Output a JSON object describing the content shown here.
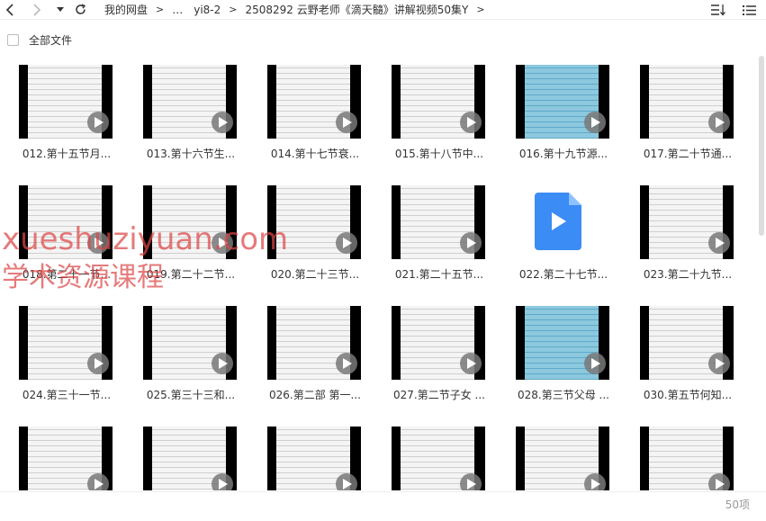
{
  "toolbar": {
    "breadcrumb": [
      "我的网盘",
      "…",
      "yi8-2",
      "2508292 云野老师《滴天髓》讲解视频50集Y"
    ],
    "separator": ">",
    "back_icon": "chevron-left-icon",
    "forward_icon": "chevron-right-icon",
    "history_icon": "caret-down-icon",
    "refresh_icon": "refresh-icon",
    "sort_icon": "sort-icon",
    "view_icon": "list-view-icon"
  },
  "select_all": {
    "label": "全部文件"
  },
  "files": [
    {
      "name": "012.第十五节月...",
      "thumb": "doc"
    },
    {
      "name": "013.第十六节生...",
      "thumb": "doc"
    },
    {
      "name": "014.第十七节衰...",
      "thumb": "doc"
    },
    {
      "name": "015.第十八节中...",
      "thumb": "doc"
    },
    {
      "name": "016.第十九节源...",
      "thumb": "blue"
    },
    {
      "name": "017.第二十节通...",
      "thumb": "doc"
    },
    {
      "name": "018.第二十一节...",
      "thumb": "doc"
    },
    {
      "name": "019.第二十二节...",
      "thumb": "doc"
    },
    {
      "name": "020.第二十三节...",
      "thumb": "doc"
    },
    {
      "name": "021.第二十五节...",
      "thumb": "doc"
    },
    {
      "name": "022.第二十七节...",
      "thumb": "icon"
    },
    {
      "name": "023.第二十九节...",
      "thumb": "doc"
    },
    {
      "name": "024.第三十一节...",
      "thumb": "doc"
    },
    {
      "name": "025.第三十三和...",
      "thumb": "doc"
    },
    {
      "name": "026.第二部  第一...",
      "thumb": "doc"
    },
    {
      "name": "027.第二节子女 ...",
      "thumb": "doc"
    },
    {
      "name": "028.第三节父母 ...",
      "thumb": "blue"
    },
    {
      "name": "030.第五节何知...",
      "thumb": "doc"
    },
    {
      "name": "",
      "thumb": "doc"
    },
    {
      "name": "",
      "thumb": "doc"
    },
    {
      "name": "",
      "thumb": "doc"
    },
    {
      "name": "",
      "thumb": "doc"
    },
    {
      "name": "",
      "thumb": "doc"
    },
    {
      "name": "",
      "thumb": "doc"
    }
  ],
  "status": {
    "count": "50项"
  },
  "watermark": {
    "line1": "xueshuziyuan.com",
    "line2": "学术资源课程"
  },
  "colors": {
    "accent": "#3b8cf5",
    "watermark": "#dc4646"
  }
}
